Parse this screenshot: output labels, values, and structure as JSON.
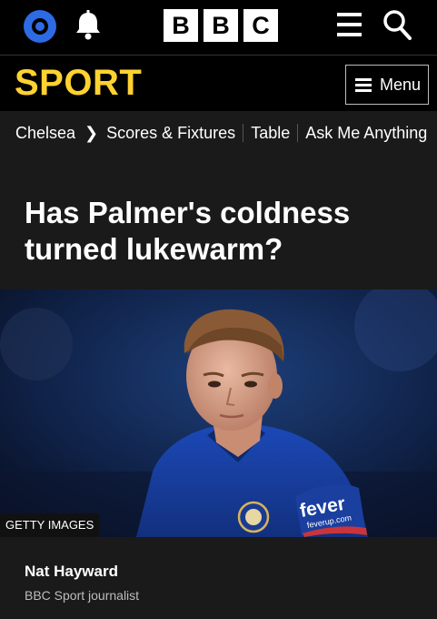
{
  "header": {
    "logo_letters": [
      "B",
      "B",
      "C"
    ],
    "icons": {
      "account": "account-icon",
      "notifications": "bell-icon",
      "menu": "hamburger-icon",
      "search": "search-icon"
    },
    "colors": {
      "account_blue": "#2d6be5",
      "background": "#000000"
    }
  },
  "sport_nav": {
    "title": "SPORT",
    "title_color": "#ffd230",
    "menu_label": "Menu"
  },
  "breadcrumb": {
    "items": [
      "Chelsea",
      "Scores & Fixtures",
      "Table",
      "Ask Me Anything"
    ]
  },
  "article": {
    "headline": "Has Palmer's coldness turned lukewarm?",
    "image_credit": "GETTY IMAGES",
    "image_sponsor_text": [
      "fever",
      "feverup.com"
    ],
    "author_name": "Nat Hayward",
    "author_role": "BBC Sport journalist"
  }
}
